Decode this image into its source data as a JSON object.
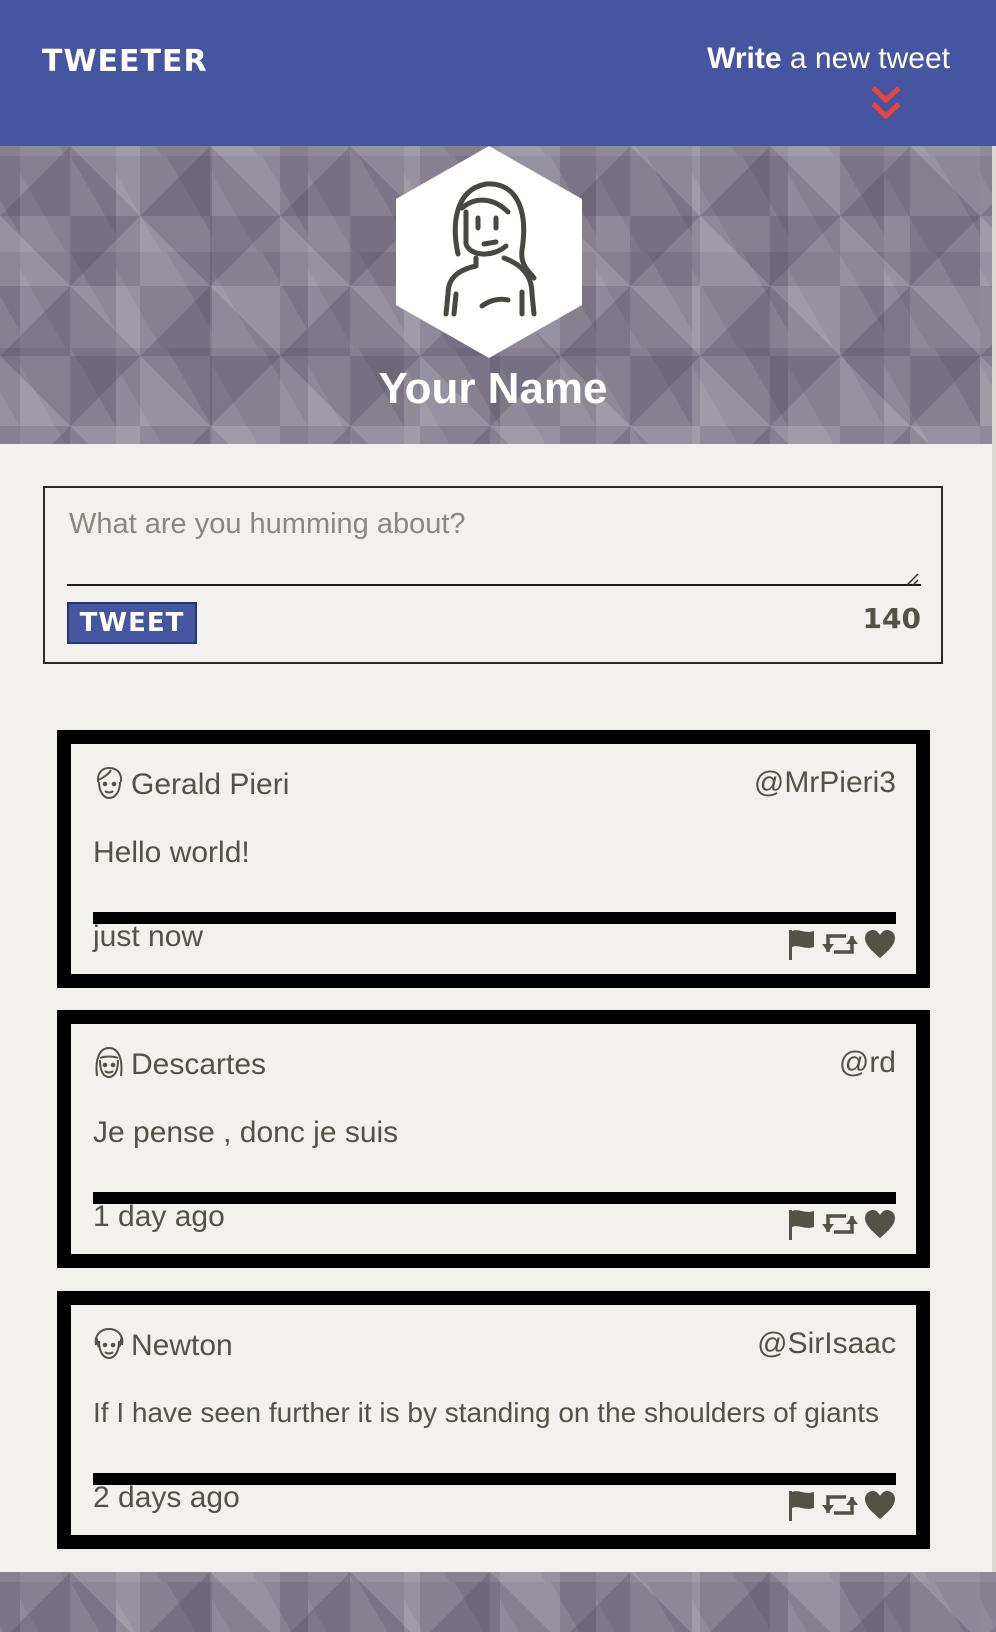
{
  "nav": {
    "brand": "TWEETER",
    "compose_bold": "Write",
    "compose_rest": " a new tweet",
    "chevron_icon": "double-chevron-down",
    "accent_color": "#e8453c",
    "bar_color": "#4655a0"
  },
  "profile": {
    "name": "Your Name",
    "avatar_icon": "woman-avatar"
  },
  "composer": {
    "placeholder": "What are you humming about?",
    "value": "",
    "button_label": "TWEET",
    "counter": "140"
  },
  "tweets": [
    {
      "avatar_icon": "face-avatar-1",
      "name": "Gerald Pieri",
      "handle": "@MrPieri3",
      "content": "Hello world!",
      "time": "just now"
    },
    {
      "avatar_icon": "face-avatar-2",
      "name": "Descartes",
      "handle": "@rd",
      "content": "Je pense , donc je suis",
      "time": "1 day ago"
    },
    {
      "avatar_icon": "face-avatar-3",
      "name": "Newton",
      "handle": "@SirIsaac",
      "content": "If I have seen further it is by standing on the shoulders of giants",
      "time": "2 days ago"
    }
  ],
  "actions": [
    "flag-icon",
    "retweet-icon",
    "heart-icon"
  ]
}
